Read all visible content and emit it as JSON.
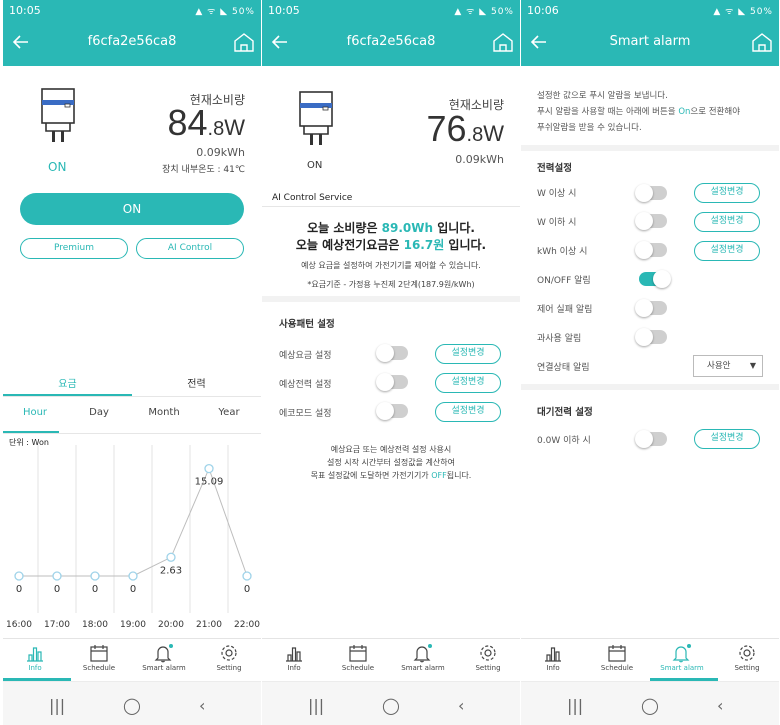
{
  "screens": [
    {
      "status": {
        "time": "10:05",
        "battery": "50%"
      },
      "title": "f6cfa2e56ca8",
      "consumption_label": "현재소비량",
      "power_int": "84",
      "power_dec": ".8",
      "power_unit": "W",
      "energy": "0.09kWh",
      "device_state": "ON",
      "temp": "장치 내부온도 : 41℃",
      "on_button": "ON",
      "premium_button": "Premium",
      "ai_button": "AI Control",
      "tabs": [
        "요금",
        "전력"
      ],
      "periods": [
        "Hour",
        "Day",
        "Month",
        "Year"
      ],
      "unit_label": "단위 : Won",
      "nav": [
        "Info",
        "Schedule",
        "Smart alarm",
        "Setting"
      ]
    },
    {
      "status": {
        "time": "10:05",
        "battery": "50%"
      },
      "title": "f6cfa2e56ca8",
      "consumption_label": "현재소비량",
      "power_int": "76",
      "power_dec": ".8",
      "power_unit": "W",
      "energy": "0.09kWh",
      "device_state": "ON",
      "ai_section": "AI Control Service",
      "line1_pre": "오늘 소비량은 ",
      "line1_val": "89.0Wh",
      "line1_post": " 입니다.",
      "line2_pre": "오늘 예상전기요금은 ",
      "line2_val": "16.7원",
      "line2_post": " 입니다.",
      "desc": "예상 요금을 설정하여 가전기기를 제어할 수 있습니다.",
      "note": "*요금기준 - 가정용 누진제 2단계(187.9원/kWh)",
      "pattern_title": "사용패턴 설정",
      "pattern_rows": [
        {
          "label": "예상요금 설정",
          "button": "설정변경"
        },
        {
          "label": "예상전력 설정",
          "button": "설정변경"
        },
        {
          "label": "에코모드 설정",
          "button": "설정변경"
        }
      ],
      "info1": "예상요금 또는 예상전력 설정 사용시",
      "info2": "설정 시작 시간부터 설정값을 계산하여",
      "info3_pre": "목표 설정값에 도달하면 가전기기가 ",
      "info3_val": "OFF",
      "info3_post": "됩니다.",
      "nav": [
        "Info",
        "Schedule",
        "Smart alarm",
        "Setting"
      ]
    },
    {
      "status": {
        "time": "10:06",
        "battery": "50%"
      },
      "title": "Smart alarm",
      "intro1": "설정한 값으로 푸시 알람을 보냅니다.",
      "intro2_pre": "푸시 알람을 사용할 때는 아래에 버튼을 ",
      "intro2_val": "On",
      "intro2_post": "으로 전환해야",
      "intro3": "푸쉬알람을 받을 수 있습니다.",
      "power_title": "전력설정",
      "rows": [
        {
          "label": "W 이상 시",
          "on": false,
          "button": "설정변경"
        },
        {
          "label": "W 이하 시",
          "on": false,
          "button": "설정변경"
        },
        {
          "label": "kWh 이상 시",
          "on": false,
          "button": "설정변경"
        },
        {
          "label": "ON/OFF 알림",
          "on": true,
          "button": ""
        },
        {
          "label": "제어 실패 알림",
          "on": false,
          "button": ""
        },
        {
          "label": "과사용 알림",
          "on": false,
          "button": ""
        }
      ],
      "conn_label": "연결상태 알림",
      "conn_select": "사용안",
      "standby_title": "대기전력 설정",
      "standby_label": "0.0W 이하 시",
      "standby_button": "설정변경",
      "nav": [
        "Info",
        "Schedule",
        "Smart alarm",
        "Setting"
      ]
    }
  ],
  "chart_data": {
    "type": "line",
    "title": "",
    "xlabel": "",
    "ylabel": "단위 : Won",
    "categories": [
      "16:00",
      "17:00",
      "18:00",
      "19:00",
      "20:00",
      "21:00",
      "22:00"
    ],
    "values": [
      0,
      0,
      0,
      0,
      2.63,
      15.09,
      0
    ],
    "value_labels": [
      "0",
      "0",
      "0",
      "0",
      "2.63",
      "15.09",
      "0"
    ],
    "ylim": [
      0,
      17
    ],
    "grid": true,
    "color": "#9fd3e9"
  },
  "colors": {
    "accent": "#2ab8b5",
    "nav_dot": "#2ab8b5"
  }
}
